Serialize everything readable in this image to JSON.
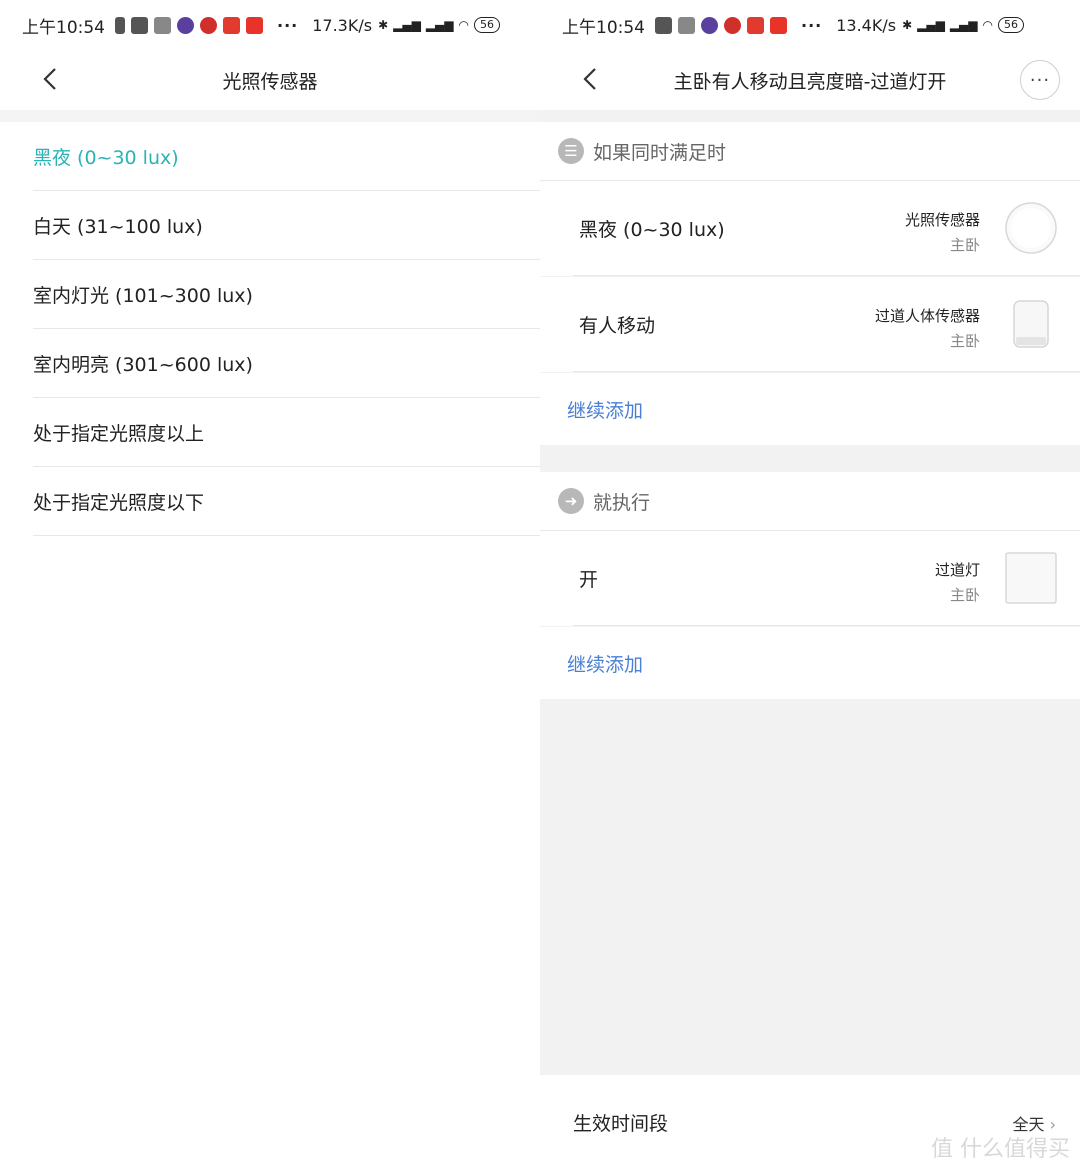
{
  "left": {
    "status": {
      "time": "上午10:54",
      "speed": "17.3K/s",
      "battery": "56"
    },
    "title": "光照传感器",
    "options": [
      {
        "label": "黑夜 (0~30 lux)",
        "selected": true
      },
      {
        "label": "白天 (31~100 lux)",
        "selected": false
      },
      {
        "label": "室内灯光 (101~300 lux)",
        "selected": false
      },
      {
        "label": "室内明亮 (301~600 lux)",
        "selected": false
      },
      {
        "label": "处于指定光照度以上",
        "selected": false
      },
      {
        "label": "处于指定光照度以下",
        "selected": false
      }
    ]
  },
  "right": {
    "status": {
      "time": "上午10:54",
      "speed": "13.4K/s",
      "battery": "56"
    },
    "title": "主卧有人移动且亮度暗-过道灯开",
    "more_label": "···",
    "conditions": {
      "heading": "如果同时满足时",
      "items": [
        {
          "label": "黑夜 (0~30 lux)",
          "device": "光照传感器",
          "room": "主卧"
        },
        {
          "label": "有人移动",
          "device": "过道人体传感器",
          "room": "主卧"
        }
      ],
      "add_more": "继续添加"
    },
    "actions": {
      "heading": "就执行",
      "items": [
        {
          "label": "开",
          "device": "过道灯",
          "room": "主卧"
        }
      ],
      "add_more": "继续添加"
    },
    "schedule": {
      "label": "生效时间段",
      "value": "全天"
    },
    "watermark": "值 什么值得买"
  },
  "colors": {
    "accent": "#2bb3b6",
    "link": "#4a7fd6",
    "section_bg": "#f2f2f2"
  }
}
